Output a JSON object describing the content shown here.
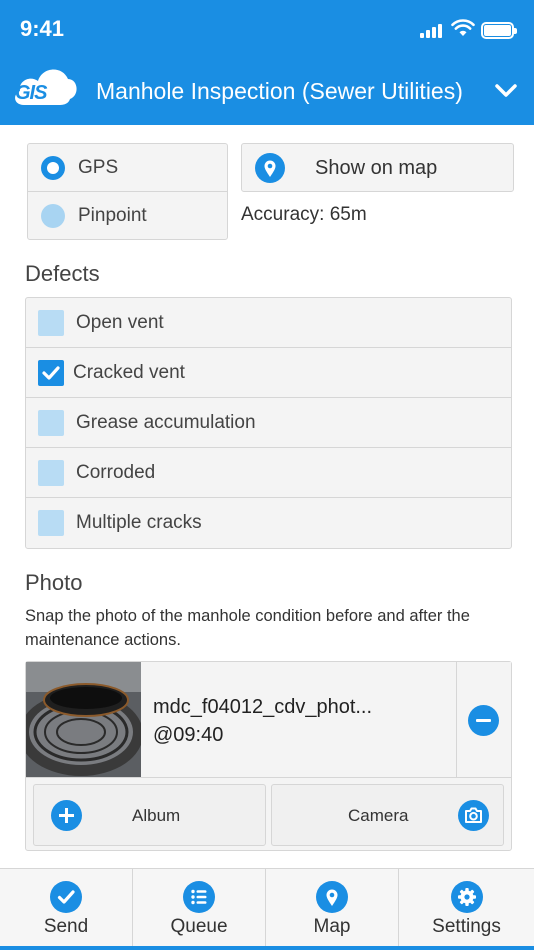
{
  "status_bar": {
    "time": "9:41"
  },
  "header": {
    "logo_text": "GIS",
    "title": "Manhole Inspection (Sewer Utilities)"
  },
  "location": {
    "options": [
      {
        "label": "GPS",
        "selected": true
      },
      {
        "label": "Pinpoint",
        "selected": false
      }
    ],
    "show_on_map_label": "Show on map",
    "accuracy": "Accuracy: 65m"
  },
  "defects": {
    "heading": "Defects",
    "items": [
      {
        "label": "Open vent",
        "checked": false
      },
      {
        "label": "Cracked vent",
        "checked": true
      },
      {
        "label": "Grease accumulation",
        "checked": false
      },
      {
        "label": "Corroded",
        "checked": false
      },
      {
        "label": "Multiple cracks",
        "checked": false
      }
    ]
  },
  "photo": {
    "heading": "Photo",
    "description": "Snap the photo of the manhole condition before and after the maintenance actions.",
    "file_name": "mdc_f04012_cdv_phot...",
    "time": "@09:40",
    "album_label": "Album",
    "camera_label": "Camera"
  },
  "tabs": [
    {
      "label": "Send",
      "icon": "check-circle-icon"
    },
    {
      "label": "Queue",
      "icon": "list-icon"
    },
    {
      "label": "Map",
      "icon": "map-pin-icon"
    },
    {
      "label": "Settings",
      "icon": "gear-icon"
    }
  ],
  "colors": {
    "primary": "#1a8ee3",
    "light_blue": "#b8dcf4",
    "panel": "#f4f4f4",
    "border": "#d6d6d6"
  }
}
